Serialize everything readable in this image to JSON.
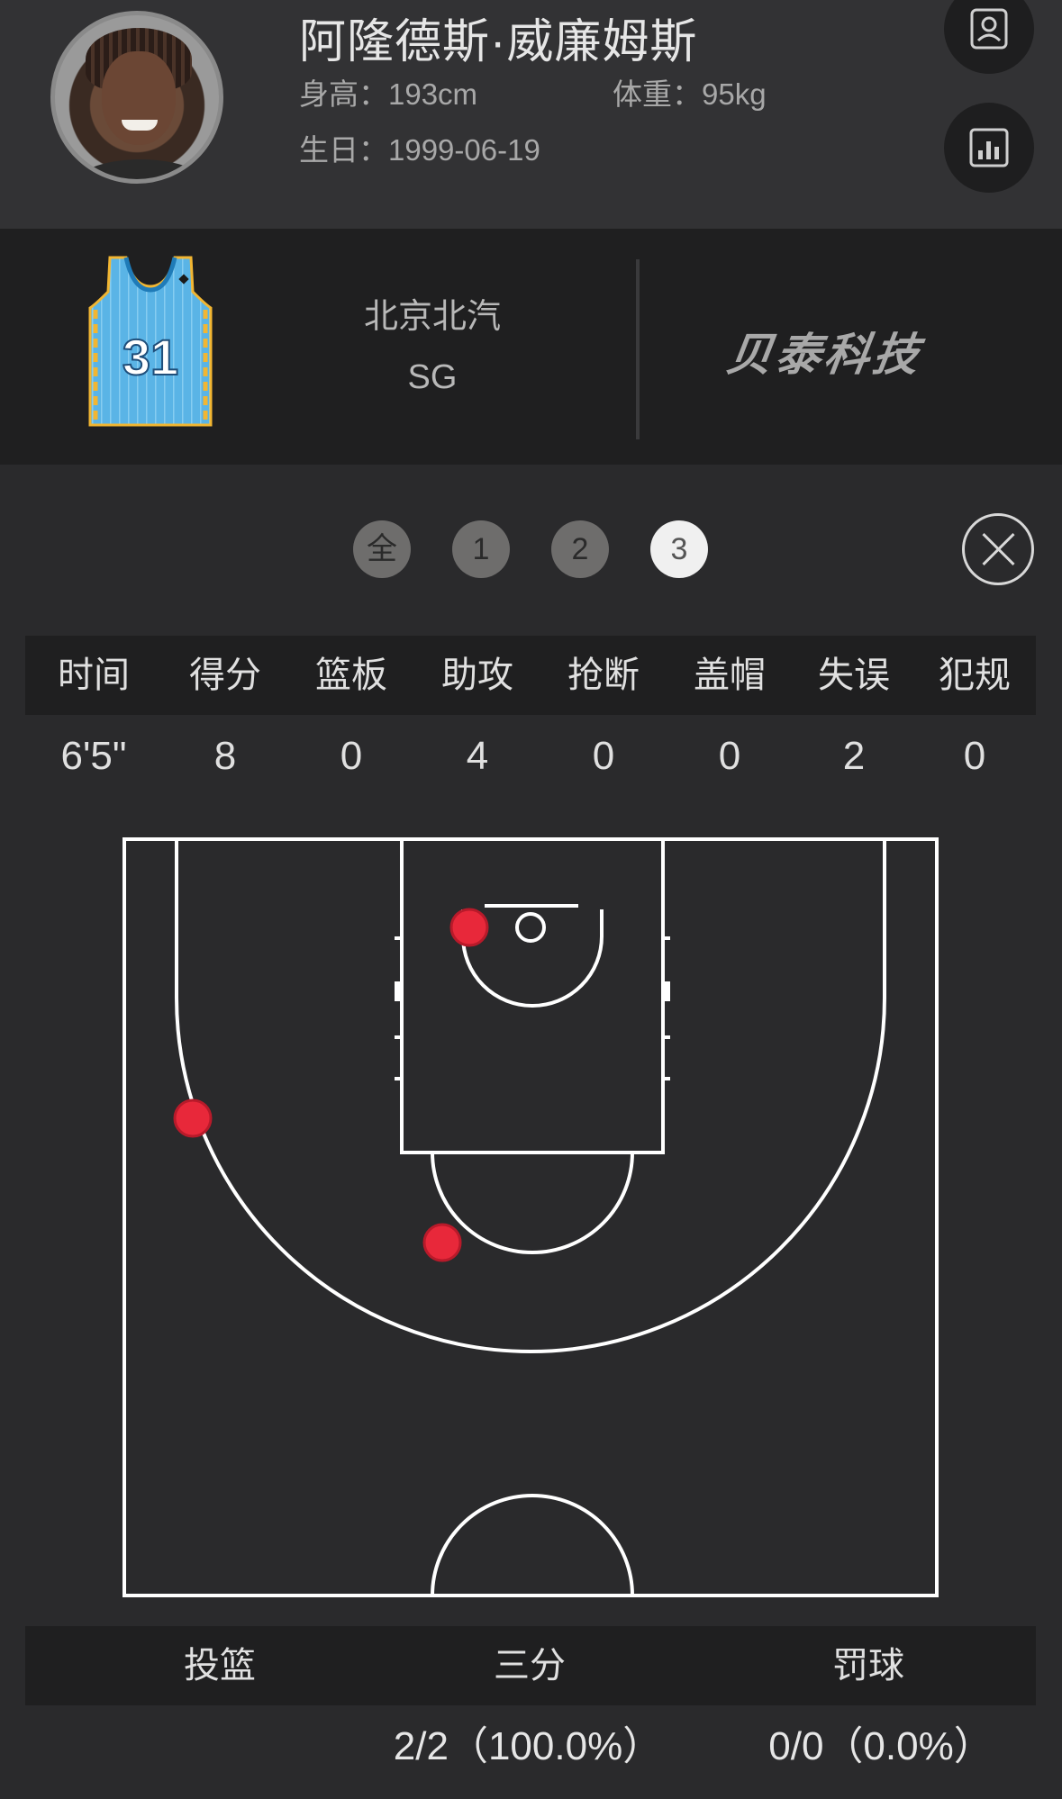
{
  "player": {
    "name": "阿隆德斯·威廉姆斯",
    "height": "身高：193cm",
    "weight": "体重：95kg",
    "birthday": "生日：1999-06-19"
  },
  "team": {
    "jersey_number": "31",
    "name": "北京北汽",
    "position": "SG",
    "brand": "贝泰科技"
  },
  "periods": {
    "items": [
      "全",
      "1",
      "2",
      "3"
    ],
    "selected": "3"
  },
  "stats": {
    "headers": [
      "时间",
      "得分",
      "篮板",
      "助攻",
      "抢断",
      "盖帽",
      "失误",
      "犯规"
    ],
    "values": [
      "6'5\"",
      "8",
      "0",
      "4",
      "0",
      "0",
      "2",
      "0"
    ]
  },
  "shots": [
    {
      "zone": "near rim",
      "made": true
    },
    {
      "zone": "left three",
      "made": true
    },
    {
      "zone": "top of key three",
      "made": true
    }
  ],
  "shooting": {
    "headers": [
      "投篮",
      "三分",
      "罚球"
    ],
    "values": [
      "",
      "2/2（100.0%）",
      "0/0（0.0%）"
    ]
  },
  "colors": {
    "background": "#2a2a2c",
    "band": "#1f1f20",
    "court_line": "#ffffff",
    "shot_made": "#e8283a",
    "period_active": "#f0f0f0",
    "period_inactive": "#6e6d6c"
  },
  "icons": [
    "player-card-icon",
    "stats-chart-icon",
    "close-icon"
  ]
}
